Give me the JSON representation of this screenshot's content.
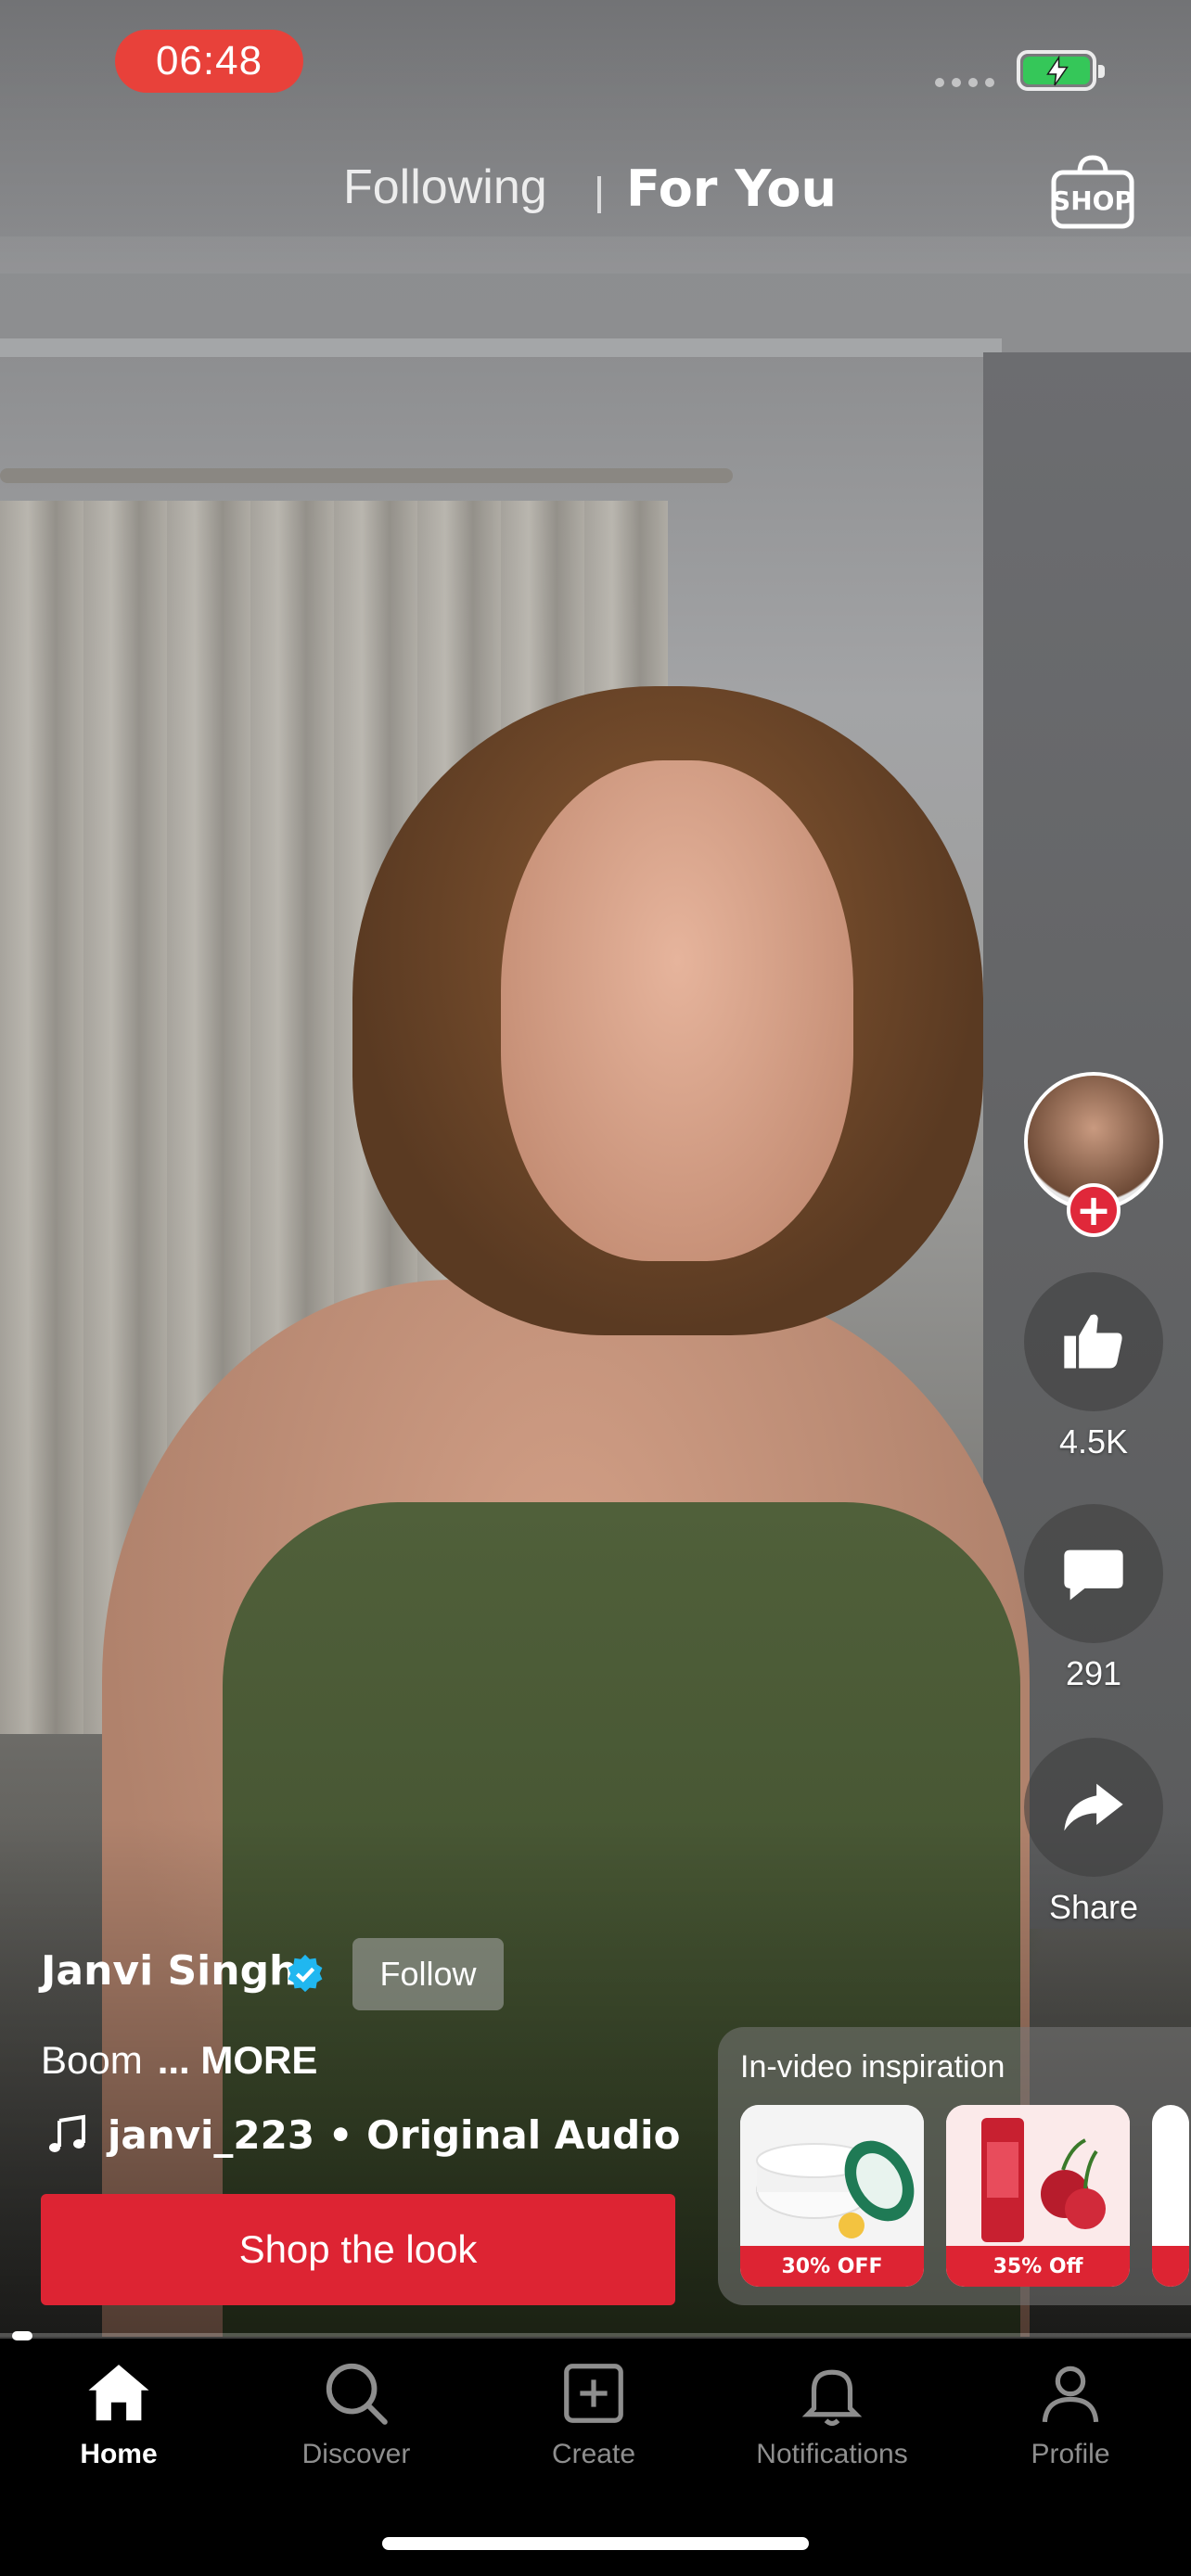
{
  "status_bar": {
    "time": "06:48"
  },
  "top_nav": {
    "tabs": [
      {
        "label": "Following",
        "active": false
      },
      {
        "label": "For You",
        "active": true
      }
    ],
    "shop_label": "SHOP"
  },
  "right_rail": {
    "likes": "4.5K",
    "comments": "291",
    "share_label": "Share"
  },
  "creator": {
    "name": "Janvi Singh",
    "verified": true,
    "follow_label": "Follow",
    "caption": "Boom",
    "more_label": "... MORE",
    "audio": "janvi_223 • Original Audio"
  },
  "shop_look": {
    "label": "Shop the look"
  },
  "inspiration": {
    "title": "In-video inspiration",
    "products": [
      {
        "discount": "30% OFF"
      },
      {
        "discount": "35% Off"
      }
    ]
  },
  "video_progress": 0.01,
  "bottom_nav": {
    "items": [
      {
        "label": "Home",
        "icon": "home-icon",
        "active": true
      },
      {
        "label": "Discover",
        "icon": "search-icon",
        "active": false
      },
      {
        "label": "Create",
        "icon": "create-icon",
        "active": false
      },
      {
        "label": "Notifications",
        "icon": "bell-icon",
        "active": false
      },
      {
        "label": "Profile",
        "icon": "profile-icon",
        "active": false
      }
    ]
  },
  "colors": {
    "accent_red": "#dd2433",
    "battery_green": "#35c759",
    "verified_blue": "#20b7f0"
  }
}
